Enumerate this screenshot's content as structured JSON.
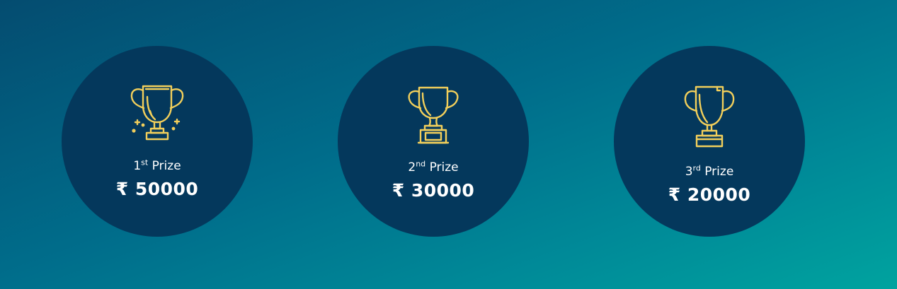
{
  "accent_color": "#f2cf5b",
  "prizes": [
    {
      "rank": "1",
      "suffix": "st",
      "label": "Prize",
      "currency": "₹",
      "amount": "50000",
      "icon": "trophy-sparkle-icon"
    },
    {
      "rank": "2",
      "suffix": "nd",
      "label": "Prize",
      "currency": "₹",
      "amount": "30000",
      "icon": "trophy-plaque-icon"
    },
    {
      "rank": "3",
      "suffix": "rd",
      "label": "Prize",
      "currency": "₹",
      "amount": "20000",
      "icon": "trophy-tall-icon"
    }
  ]
}
